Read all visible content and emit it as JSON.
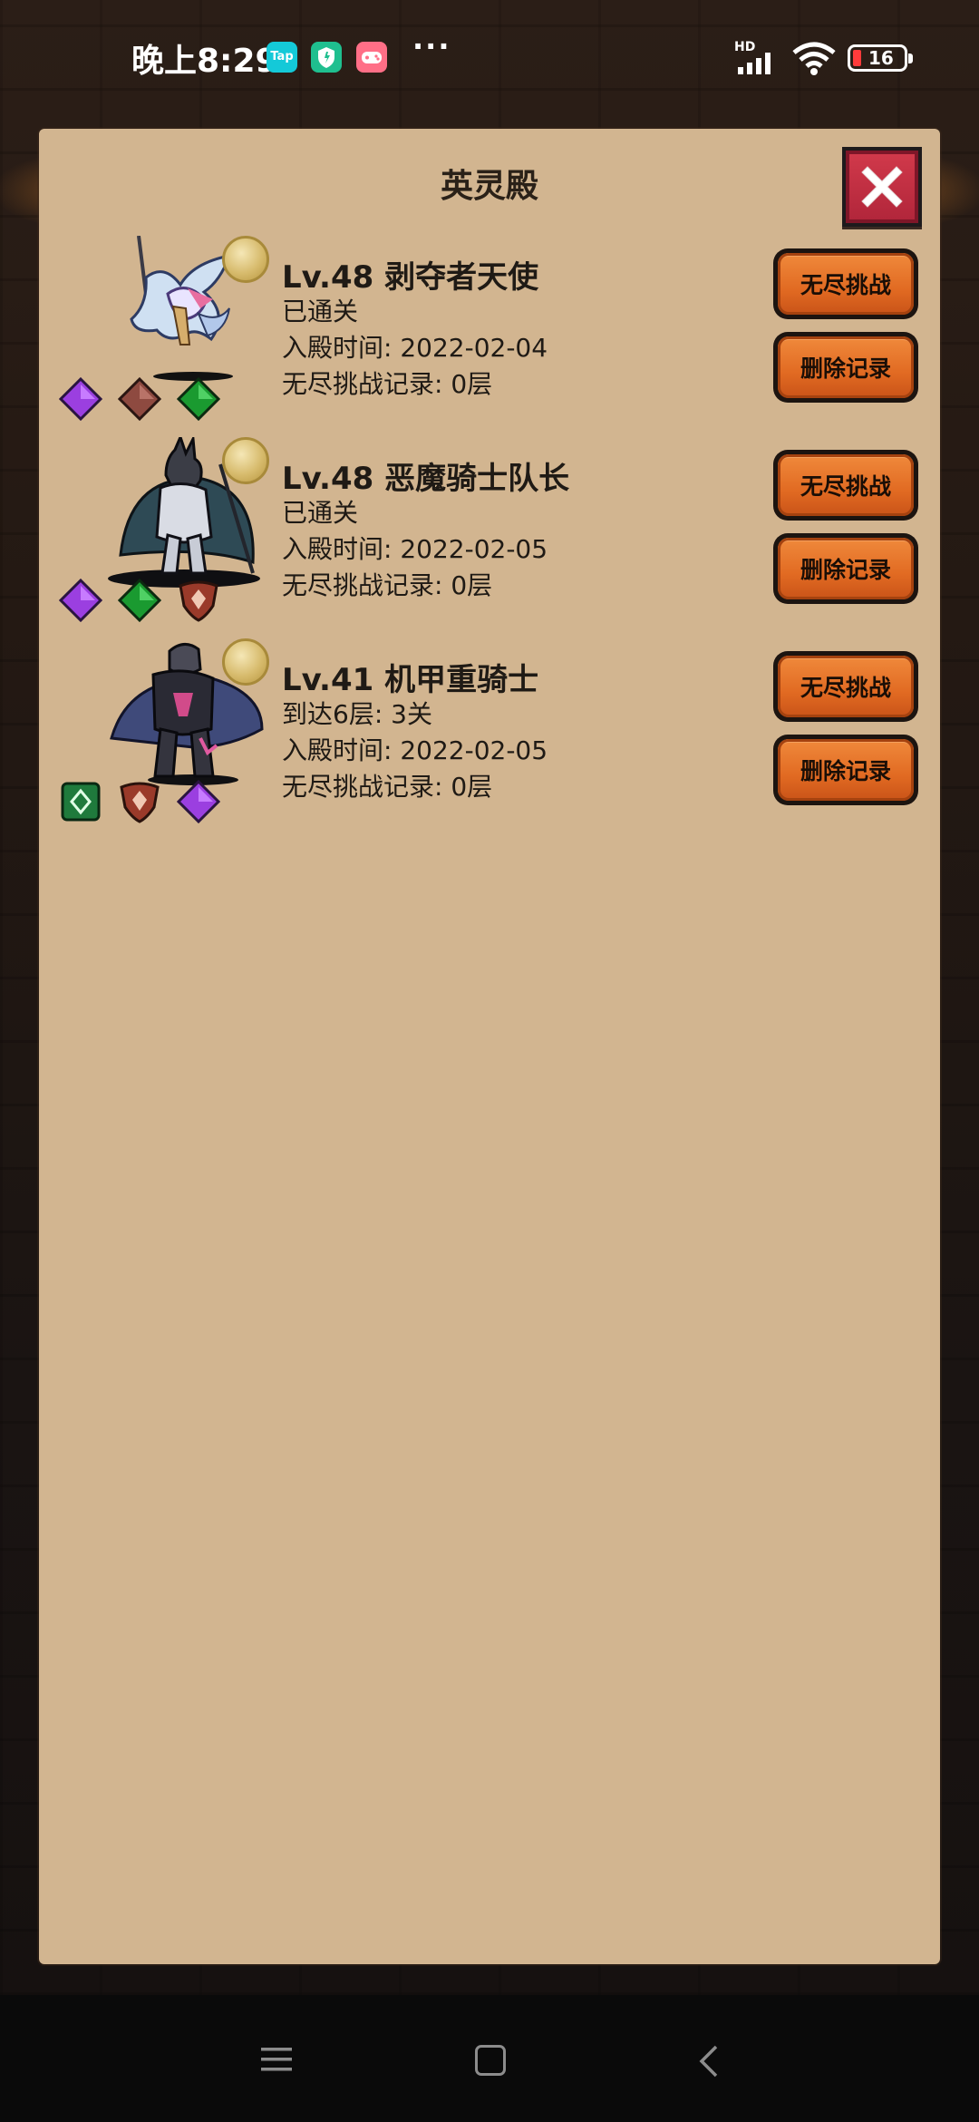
{
  "status_bar": {
    "time": "晚上8:29",
    "app_icons": [
      "tap-icon",
      "shield-app-icon",
      "game-app-icon"
    ],
    "tap_label": "Tap",
    "more": "···",
    "network_label": "HD",
    "battery": "16"
  },
  "panel": {
    "title": "英灵殿",
    "close_icon": "close-icon"
  },
  "heroes": [
    {
      "name": "Lv.48 剥夺者天使",
      "status": "已通关",
      "enter_time": "入殿时间: 2022-02-04",
      "endless_record": "无尽挑战记录: 0层",
      "gems": [
        "purple-diamond",
        "brown-diamond",
        "green-diamond"
      ],
      "challenge_label": "无尽挑战",
      "delete_label": "删除记录"
    },
    {
      "name": "Lv.48 恶魔骑士队长",
      "status": "已通关",
      "enter_time": "入殿时间: 2022-02-05",
      "endless_record": "无尽挑战记录: 0层",
      "gems": [
        "purple-diamond",
        "green-diamond",
        "red-shield"
      ],
      "challenge_label": "无尽挑战",
      "delete_label": "删除记录"
    },
    {
      "name": "Lv.41 机甲重骑士",
      "status": "到达6层: 3关",
      "enter_time": "入殿时间: 2022-02-05",
      "endless_record": "无尽挑战记录: 0层",
      "gems": [
        "green-card",
        "red-shield",
        "purple-diamond"
      ],
      "challenge_label": "无尽挑战",
      "delete_label": "删除记录"
    }
  ],
  "colors": {
    "panel": "#d2b590",
    "button_orange": "#e16a22",
    "close_red": "#c2303f"
  }
}
